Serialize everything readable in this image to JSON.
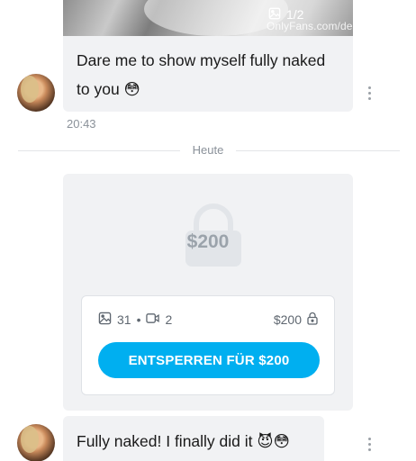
{
  "messages": [
    {
      "media_counter": "1/2",
      "watermark": "OnlyFans.com/deborah_tmz",
      "text": "Dare me to show myself fully naked to you 😳",
      "time": "20:43"
    },
    {
      "text": "Fully naked! I finally did it 😈😳"
    }
  ],
  "date_divider": "Heute",
  "locked_post": {
    "lock_price": "$200",
    "photo_count": "31",
    "separator": "•",
    "video_count": "2",
    "price": "$200",
    "unlock_label": "ENTSPERREN FÜR $200"
  },
  "colors": {
    "accent": "#00aff0",
    "bubble_bg": "#f1f2f4",
    "muted_text": "#8a9199"
  }
}
